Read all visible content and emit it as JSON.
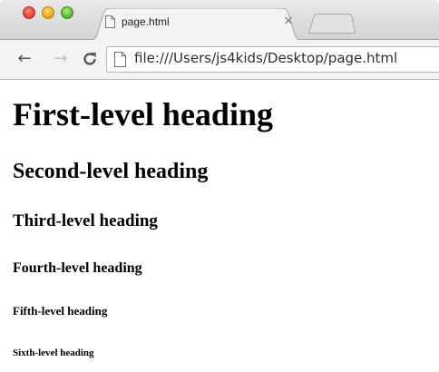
{
  "window": {
    "controls": [
      "close",
      "minimize",
      "zoom"
    ]
  },
  "tab": {
    "title": "page.html",
    "close_glyph": "×",
    "icon": "document-icon"
  },
  "toolbar": {
    "back_glyph": "←",
    "forward_glyph": "→",
    "reload_glyph": "C",
    "url": "file:///Users/js4kids/Desktop/page.html",
    "page_icon": "document-icon"
  },
  "page": {
    "h1": "First-level heading",
    "h2": "Second-level heading",
    "h3": "Third-level heading",
    "h4": "Fourth-level heading",
    "h5": "Fifth-level heading",
    "h6": "Sixth-level heading"
  }
}
